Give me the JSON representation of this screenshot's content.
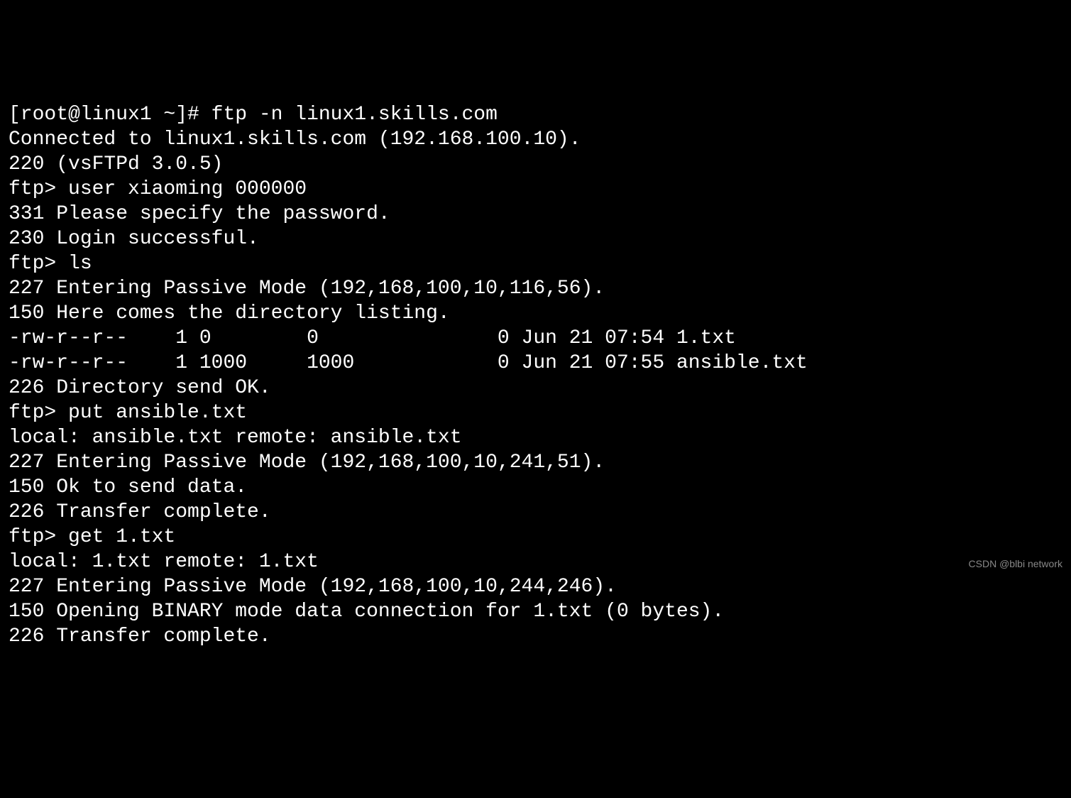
{
  "terminal": {
    "lines": [
      "[root@linux1 ~]# ftp -n linux1.skills.com",
      "Connected to linux1.skills.com (192.168.100.10).",
      "220 (vsFTPd 3.0.5)",
      "ftp> user xiaoming 000000",
      "331 Please specify the password.",
      "230 Login successful.",
      "ftp> ls",
      "227 Entering Passive Mode (192,168,100,10,116,56).",
      "150 Here comes the directory listing.",
      "-rw-r--r--    1 0        0               0 Jun 21 07:54 1.txt",
      "-rw-r--r--    1 1000     1000            0 Jun 21 07:55 ansible.txt",
      "226 Directory send OK.",
      "ftp> put ansible.txt",
      "local: ansible.txt remote: ansible.txt",
      "227 Entering Passive Mode (192,168,100,10,241,51).",
      "150 Ok to send data.",
      "226 Transfer complete.",
      "ftp> get 1.txt",
      "local: 1.txt remote: 1.txt",
      "227 Entering Passive Mode (192,168,100,10,244,246).",
      "150 Opening BINARY mode data connection for 1.txt (0 bytes).",
      "226 Transfer complete."
    ]
  },
  "watermark": "CSDN @blbi network"
}
